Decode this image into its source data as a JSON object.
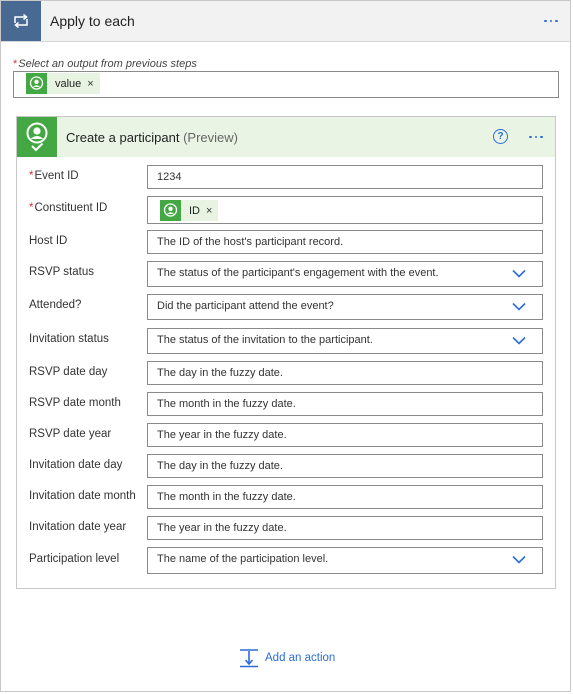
{
  "loop": {
    "title": "Apply to each",
    "select_label": "Select an output from previous steps",
    "token_label": "value",
    "token_remove": "×"
  },
  "card": {
    "title": "Create a participant",
    "preview": "(Preview)",
    "help_symbol": "?"
  },
  "fields": [
    {
      "label": "Event ID",
      "required": "*",
      "value": "1234"
    },
    {
      "label": "Constituent ID",
      "required": "*",
      "token": "ID",
      "token_remove": "×"
    },
    {
      "label": "Host ID",
      "placeholder": "The ID of the host's participant record."
    },
    {
      "label": "RSVP status",
      "placeholder": "The status of the participant's engagement with the event."
    },
    {
      "label": "Attended?",
      "placeholder": "Did the participant attend the event?"
    },
    {
      "label": "Invitation status",
      "placeholder": "The status of the invitation to the participant."
    },
    {
      "label": "RSVP date day",
      "placeholder": "The day in the fuzzy date."
    },
    {
      "label": "RSVP date month",
      "placeholder": "The month in the fuzzy date."
    },
    {
      "label": "RSVP date year",
      "placeholder": "The year in the fuzzy date."
    },
    {
      "label": "Invitation date day",
      "placeholder": "The day in the fuzzy date."
    },
    {
      "label": "Invitation date month",
      "placeholder": "The month in the fuzzy date."
    },
    {
      "label": "Invitation date year",
      "placeholder": "The year in the fuzzy date."
    },
    {
      "label": "Participation level",
      "placeholder": "The name of the participation level."
    }
  ],
  "add_action": {
    "label": "Add an action"
  },
  "colors": {
    "loop_accent": "#486991",
    "connector_green": "#43a843",
    "link_blue": "#2b6dd6",
    "required_red": "#d13438"
  },
  "icons": {
    "loop": "loop-arrows-icon",
    "connector": "person-badge-icon",
    "help": "help-circle-icon",
    "more": "more-ellipsis-icon",
    "dropdown": "chevron-down-icon",
    "add": "add-action-icon"
  }
}
